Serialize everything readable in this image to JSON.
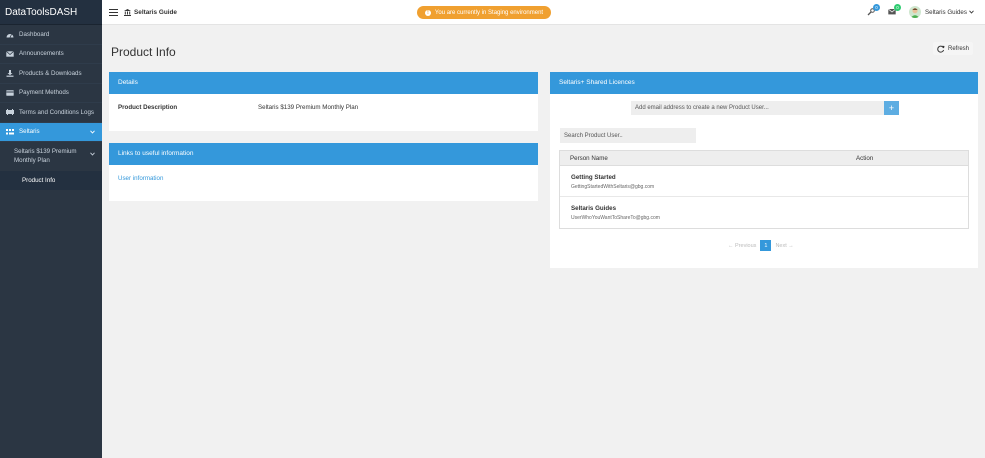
{
  "brand": "DataToolsDASH",
  "sidebar": {
    "items": [
      {
        "label": "Dashboard",
        "icon": "dashboard-icon"
      },
      {
        "label": "Announcements",
        "icon": "envelope-icon"
      },
      {
        "label": "Products & Downloads",
        "icon": "download-icon"
      },
      {
        "label": "Payment Methods",
        "icon": "credit-card-icon"
      },
      {
        "label": "Terms and Conditions Logs",
        "icon": "log-icon"
      },
      {
        "label": "Seltaris",
        "icon": "grid-icon"
      }
    ],
    "sub_item": "Seltaris $139 Premium Monthly Plan",
    "sub_child": "Product Info"
  },
  "topbar": {
    "site_title": "Seltaris Guide",
    "env_message": "You are currently in Staging environment",
    "notif_count_1": "0",
    "notif_count_2": "0",
    "user_name": "Seltaris Guides"
  },
  "colors": {
    "accent": "#3498db",
    "sidebar": "#2b3643",
    "warning": "#f0a030",
    "badge_green": "#2ecc71"
  },
  "main": {
    "title": "Product Info",
    "refresh_label": "Refresh"
  },
  "details": {
    "heading": "Details",
    "label": "Product Description",
    "value": "Seltaris $139 Premium Monthly Plan"
  },
  "links": {
    "heading": "Links to useful information",
    "item": "User information"
  },
  "licences": {
    "heading": "Seltaris+ Shared Licences",
    "add_placeholder": "Add email address to create a new Product User...",
    "add_button": "+",
    "search_placeholder": "Search Product User..",
    "columns": {
      "name": "Person Name",
      "action": "Action"
    },
    "rows": [
      {
        "name": "Getting Started",
        "email": "GettingStartedWithSeltaris@gbg.com"
      },
      {
        "name": "Seltaris Guides",
        "email": "UserWhoYouWantToShareTo@gbg.com"
      }
    ],
    "pager": {
      "prev": "← Previous",
      "page": "1",
      "next": "Next →"
    }
  }
}
